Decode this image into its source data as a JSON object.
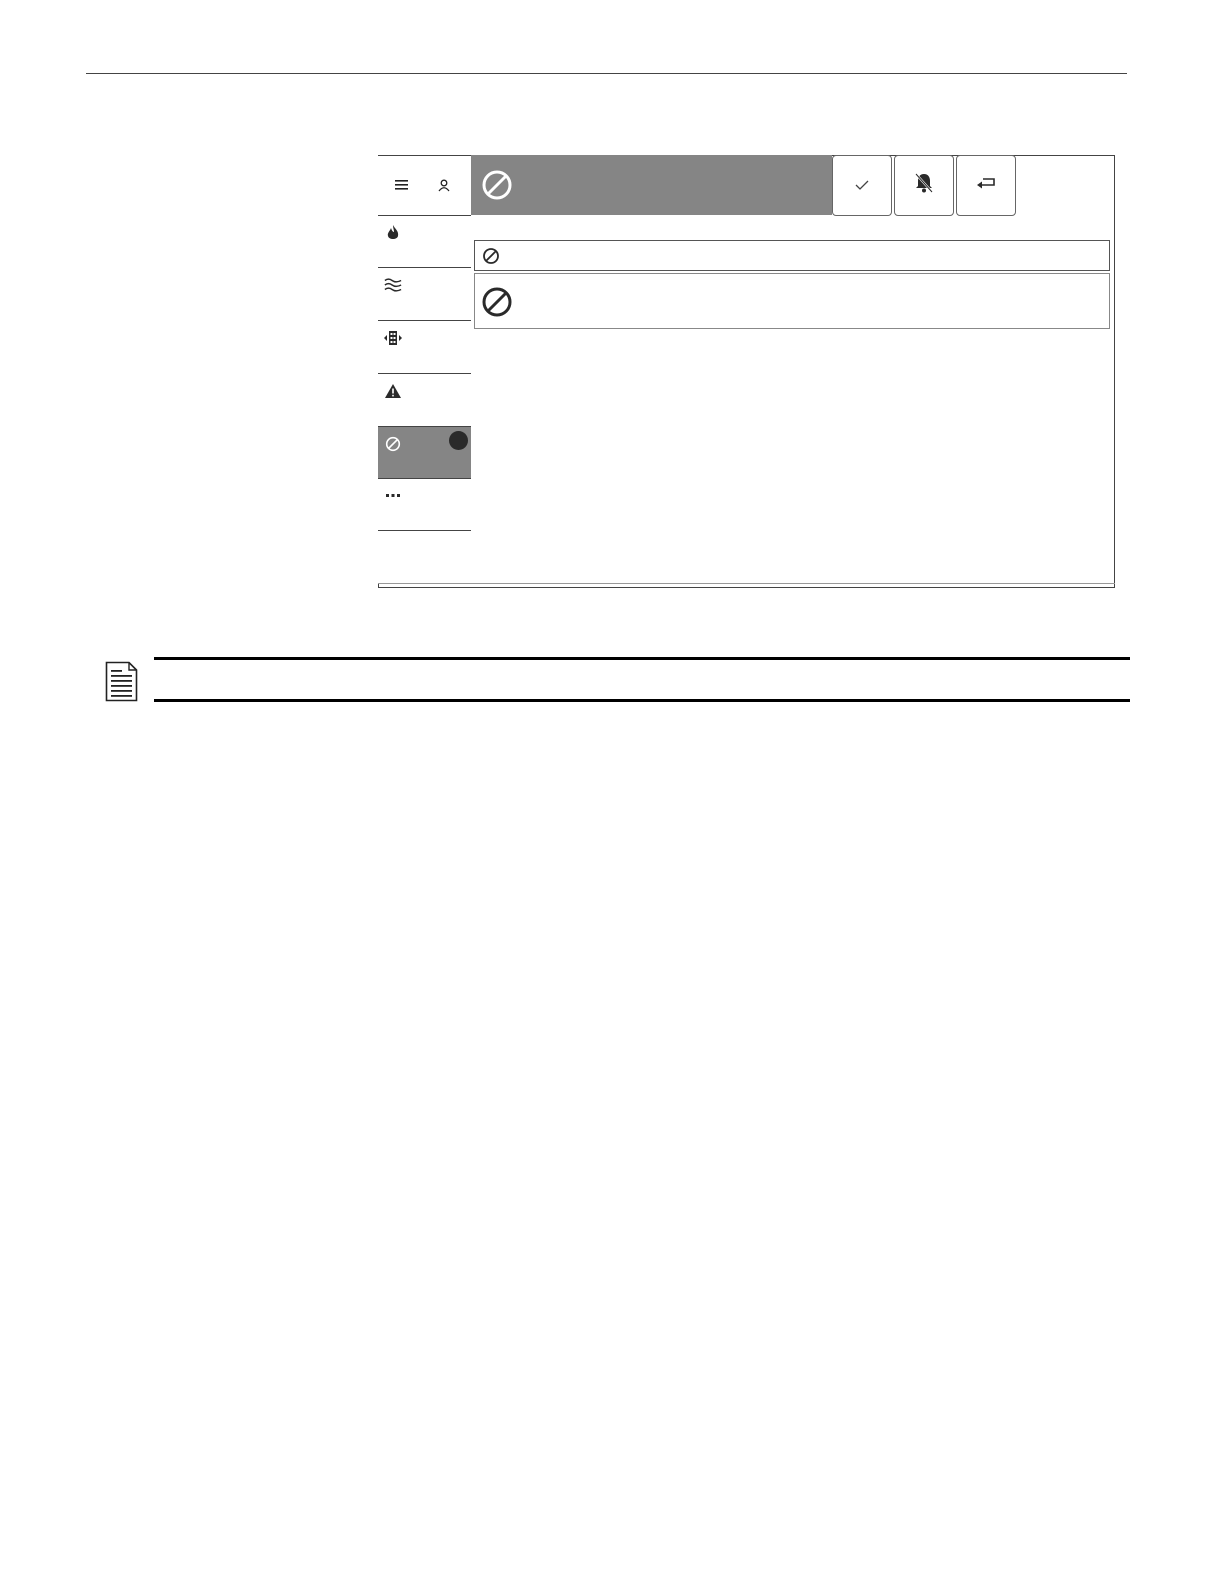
{
  "page": {
    "header_rule": true
  },
  "panel": {
    "header_icons": [
      "menu-icon",
      "user-icon"
    ],
    "sidebar_items": [
      {
        "icon": "fire-icon",
        "active": false,
        "badge": false
      },
      {
        "icon": "waves-icon",
        "active": false,
        "badge": false
      },
      {
        "icon": "building-arrows-icon",
        "active": false,
        "badge": false
      },
      {
        "icon": "warning-icon",
        "active": false,
        "badge": false
      },
      {
        "icon": "disabled-icon",
        "active": true,
        "badge": true
      },
      {
        "icon": "more-icon",
        "active": false,
        "badge": false
      },
      {
        "icon": "",
        "active": false,
        "badge": false
      }
    ],
    "title_icon": "disabled-icon",
    "toolbar_buttons": [
      "acknowledge-check-icon",
      "silence-bell-icon",
      "return-arrow-icon"
    ],
    "list_rows": [
      {
        "icon": "disabled-icon",
        "text": ""
      },
      {
        "icon": "disabled-icon",
        "text": ""
      }
    ]
  },
  "note": {
    "icon": "note-document-icon",
    "text": ""
  },
  "colors": {
    "active_gray": "#858585",
    "badge": "#2a2a2a",
    "border": "#444444"
  }
}
